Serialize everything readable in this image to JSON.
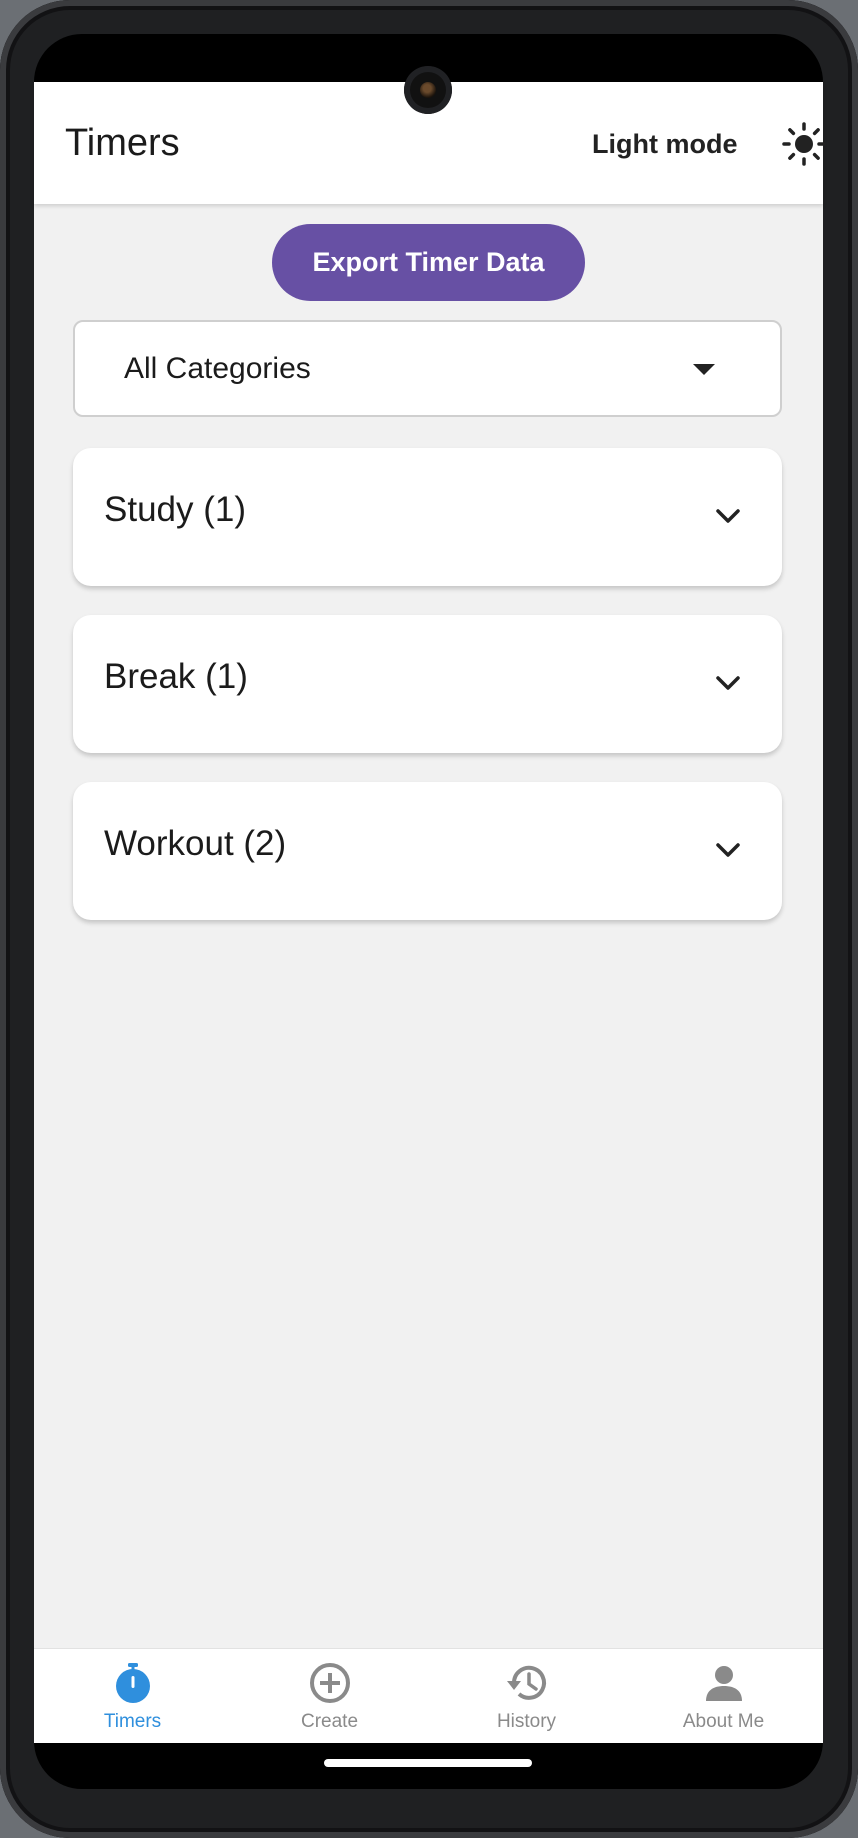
{
  "header": {
    "title": "Timers",
    "mode_label": "Light mode",
    "mode_icon": "sun-icon"
  },
  "actions": {
    "export_label": "Export Timer Data"
  },
  "filter": {
    "selected": "All Categories"
  },
  "categories": [
    {
      "label": "Study (1)"
    },
    {
      "label": "Break (1)"
    },
    {
      "label": "Workout (2)"
    }
  ],
  "nav": {
    "items": [
      {
        "label": "Timers",
        "icon": "stopwatch-icon",
        "active": true
      },
      {
        "label": "Create",
        "icon": "add-circle-icon",
        "active": false
      },
      {
        "label": "History",
        "icon": "history-icon",
        "active": false
      },
      {
        "label": "About Me",
        "icon": "person-icon",
        "active": false
      }
    ]
  },
  "colors": {
    "accent": "#6750a4",
    "nav_active": "#2f8fdd",
    "nav_inactive": "#8a8a8a",
    "background": "#f1f1f1"
  }
}
